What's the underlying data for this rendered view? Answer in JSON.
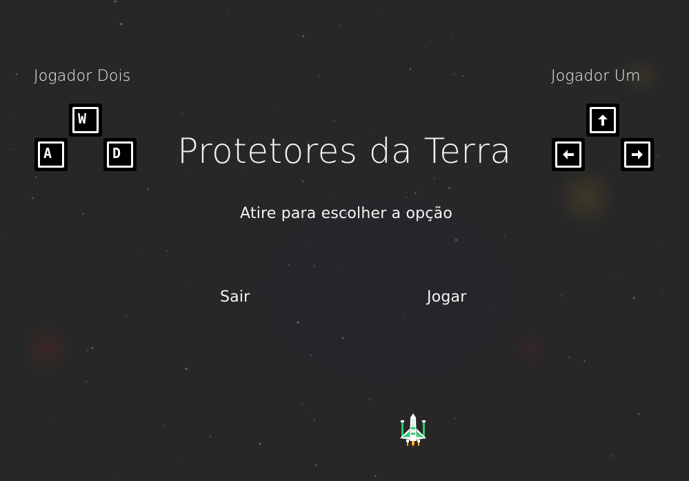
{
  "game": {
    "title": "Protetores da Terra",
    "instruction": "Atire para escolher a opção"
  },
  "players": {
    "two": {
      "label": "Jogador Dois",
      "keys": {
        "up": "W",
        "left": "A",
        "right": "D"
      }
    },
    "one": {
      "label": "Jogador Um",
      "keys": {
        "up": "arrow-up-icon",
        "left": "arrow-left-icon",
        "right": "arrow-right-icon"
      }
    }
  },
  "options": {
    "quit": "Sair",
    "play": "Jogar"
  },
  "colors": {
    "background": "#282727",
    "text": "#f4f4f4",
    "key_background": "#000000",
    "key_border": "#ffffff",
    "ship_body": "#ffffff",
    "ship_wing": "#2ecc71",
    "ship_flame": "#ffb030"
  }
}
